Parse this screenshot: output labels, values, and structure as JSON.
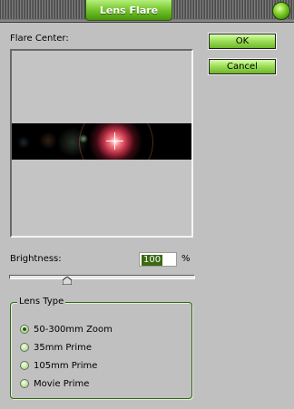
{
  "window": {
    "title": "Lens Flare"
  },
  "preview": {
    "label": "Flare Center:"
  },
  "buttons": {
    "ok": "OK",
    "cancel": "Cancel"
  },
  "brightness": {
    "label": "Brightness:",
    "value": "100",
    "unit": "%",
    "slider_fraction": 0.31
  },
  "lens_type": {
    "legend": "Lens Type",
    "options": [
      {
        "label": "50-300mm Zoom",
        "checked": true
      },
      {
        "label": "35mm Prime",
        "checked": false
      },
      {
        "label": "105mm Prime",
        "checked": false
      },
      {
        "label": "Movie Prime",
        "checked": false
      }
    ]
  },
  "colors": {
    "accent_green": "#6fc126",
    "dialog_bg": "#c0c0c0",
    "group_border": "#2d6a0a"
  },
  "icons": [
    "orb-icon",
    "crosshair-icon",
    "slider-thumb-icon"
  ]
}
